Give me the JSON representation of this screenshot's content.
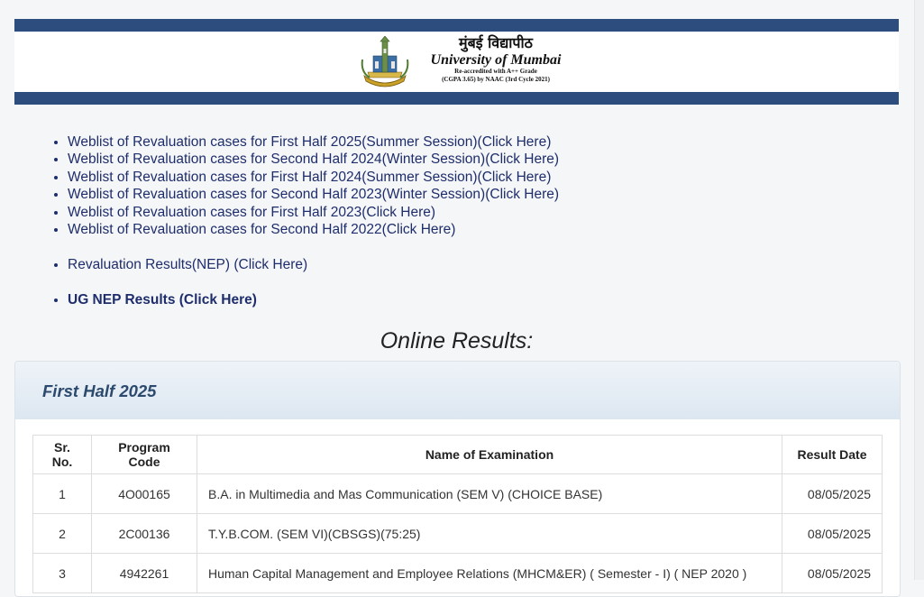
{
  "header": {
    "logo_hindi": "मुंबई विद्यापीठ",
    "logo_english": "University of Mumbai",
    "logo_line1": "Re-accredited with A++ Grade",
    "logo_line2": "(CGPA 3.65) by NAAC (3rd Cycle 2021)",
    "bar_color": "#2c4d7e"
  },
  "weblist_links": [
    "Weblist of Revaluation cases for First Half 2025(Summer Session)(Click Here)",
    "Weblist of Revaluation cases for Second Half 2024(Winter Session)(Click Here)",
    "Weblist of Revaluation cases for First Half 2024(Summer Session)(Click Here)",
    "Weblist of Revaluation cases for Second Half 2023(Winter Session)(Click Here)",
    "Weblist of Revaluation cases for First Half 2023(Click Here)",
    "Weblist of Revaluation cases for Second Half 2022(Click Here)"
  ],
  "nep_link": "Revaluation Results(NEP) (Click Here)",
  "ug_nep_link": "UG NEP Results (Click Here)",
  "section_title": "Online Results:",
  "panel": {
    "title": "First Half 2025",
    "columns": {
      "sr": "Sr. No.",
      "code": "Program Code",
      "name": "Name of Examination",
      "date": "Result Date"
    },
    "rows": [
      {
        "sr": "1",
        "code": "4O00165",
        "name": "B.A. in Multimedia and Mas Communication (SEM V) (CHOICE BASE)",
        "date": "08/05/2025"
      },
      {
        "sr": "2",
        "code": "2C00136",
        "name": "T.Y.B.COM. (SEM VI)(CBSGS)(75:25)",
        "date": "08/05/2025"
      },
      {
        "sr": "3",
        "code": "4942261",
        "name": "Human Capital Management and Employee Relations (MHCM&ER) ( Semester - I) ( NEP 2020 )",
        "date": "08/05/2025"
      }
    ]
  }
}
